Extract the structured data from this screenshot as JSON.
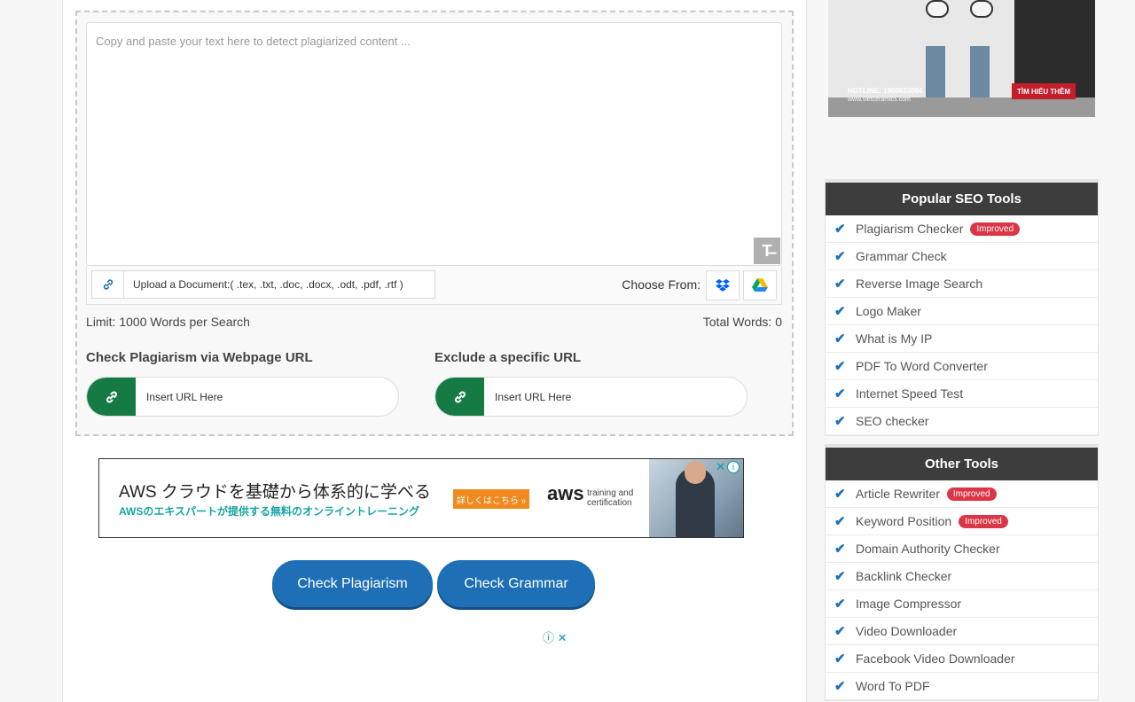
{
  "editor": {
    "placeholder": "Copy and paste your text here to detect plagiarized content ...",
    "clear_icon": "text-clear-icon",
    "upload_label": "Upload a Document:( .tex, .txt, .doc, .docx, .odt, .pdf, .rtf )",
    "choose_from": "Choose From:",
    "limit": "Limit: 1000 Words per Search",
    "total_words": "Total Words: 0"
  },
  "url_check": {
    "title": "Check Plagiarism via Webpage URL",
    "placeholder": "Insert URL Here"
  },
  "exclude_url": {
    "title": "Exclude a specific URL",
    "placeholder": "Insert URL Here"
  },
  "ad_banner": {
    "headline": "AWS クラウドを基礎から体系的に学べる",
    "subline": "AWSのエキスパートが提供する無料のオンライントレーニング",
    "cta": "詳しくはこちら »",
    "brand": "aws",
    "brand_sub_1": "training and",
    "brand_sub_2": "certification"
  },
  "actions": {
    "check_plagiarism": "Check Plagiarism",
    "check_grammar": "Check Grammar"
  },
  "side_ad": {
    "cta": "TÌM HIỂU THÊM",
    "phone": "HOTLINE: 1900633094",
    "site": "www.vietceramics.com"
  },
  "popular_tools": {
    "title": "Popular SEO Tools",
    "items": [
      {
        "label": "Plagiarism Checker",
        "badge": "Improved"
      },
      {
        "label": "Grammar Check",
        "badge": ""
      },
      {
        "label": "Reverse Image Search",
        "badge": ""
      },
      {
        "label": "Logo Maker",
        "badge": ""
      },
      {
        "label": "What is My IP",
        "badge": ""
      },
      {
        "label": "PDF To Word Converter",
        "badge": ""
      },
      {
        "label": "Internet Speed Test",
        "badge": ""
      },
      {
        "label": "SEO checker",
        "badge": ""
      }
    ]
  },
  "other_tools": {
    "title": "Other Tools",
    "items": [
      {
        "label": "Article Rewriter",
        "badge": "Improved"
      },
      {
        "label": "Keyword Position",
        "badge": "Improved"
      },
      {
        "label": "Domain Authority Checker",
        "badge": ""
      },
      {
        "label": "Backlink Checker",
        "badge": ""
      },
      {
        "label": "Image Compressor",
        "badge": ""
      },
      {
        "label": "Video Downloader",
        "badge": ""
      },
      {
        "label": "Facebook Video Downloader",
        "badge": ""
      },
      {
        "label": "Word To PDF",
        "badge": ""
      }
    ]
  },
  "colors": {
    "primary_blue": "#1e6fb5",
    "link_green": "#167a45",
    "badge_red": "#dc3545",
    "panel_header": "#3d3d3d"
  }
}
